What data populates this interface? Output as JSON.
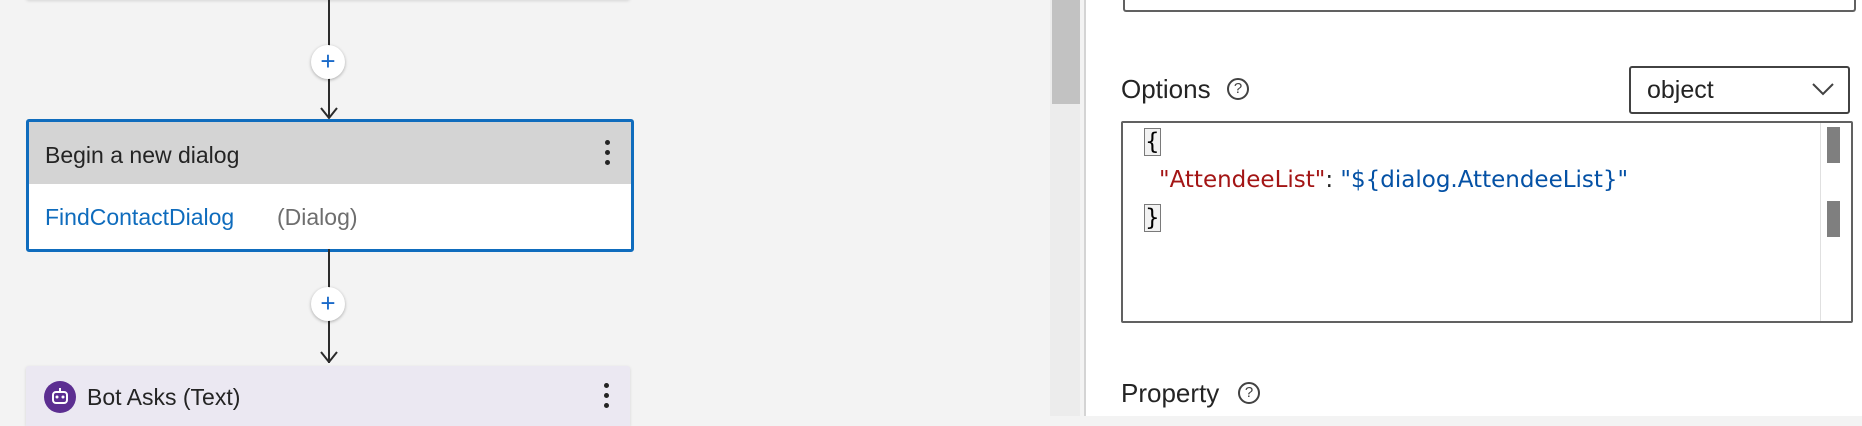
{
  "canvas": {
    "add_action_symbol": "+",
    "dialog_action": {
      "title": "Begin a new dialog",
      "dialog_name": "FindContactDialog",
      "dialog_kind": "(Dialog)"
    },
    "ask_action": {
      "title": "Bot Asks (Text)"
    }
  },
  "properties": {
    "options": {
      "label": "Options",
      "help_symbol": "?",
      "type_value": "object",
      "code": {
        "open_brace": "{",
        "key": "\"AttendeeList\"",
        "colon": ": ",
        "value": "\"${dialog.AttendeeList}\"",
        "close_brace": "}"
      }
    },
    "property": {
      "label": "Property",
      "help_symbol": "?"
    }
  },
  "icons": {
    "add": "plus-icon",
    "more": "more-vertical-icon",
    "bot": "bot-icon",
    "help": "help-circle-icon",
    "dropdown": "chevron-down-icon",
    "arrow": "arrow-down-icon"
  },
  "colors": {
    "accent": "#0f6cbd",
    "bot_badge": "#5c2e91",
    "json_key": "#a31515",
    "json_value": "#0451a5"
  }
}
